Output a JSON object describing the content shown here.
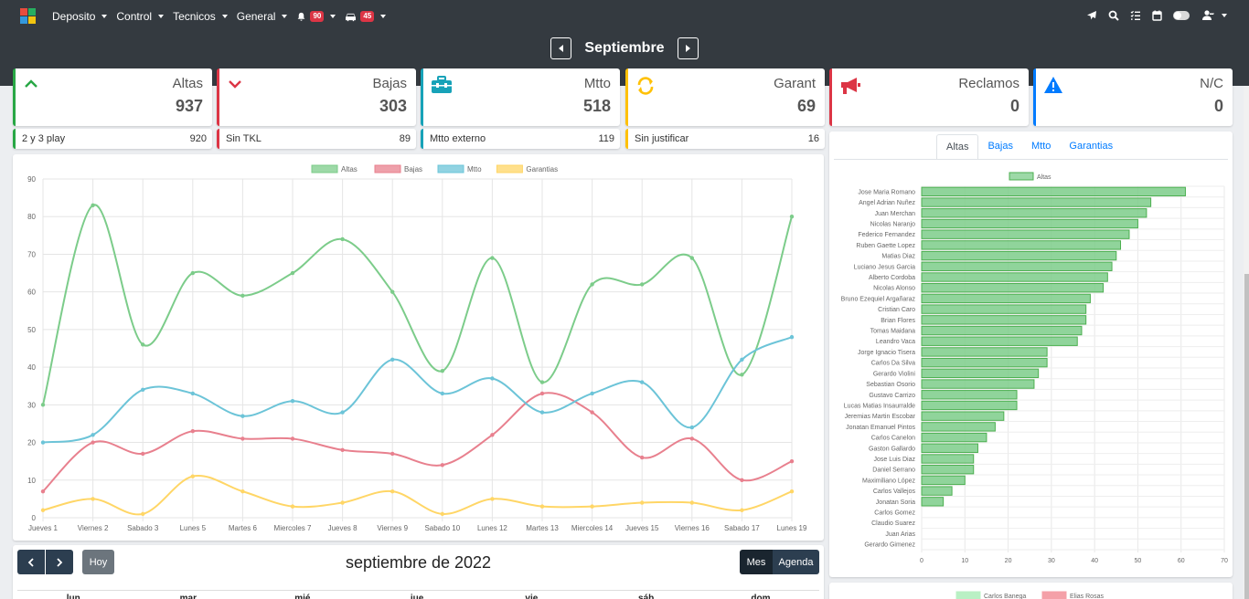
{
  "navbar": {
    "menus": [
      {
        "label": "Deposito"
      },
      {
        "label": "Control"
      },
      {
        "label": "Tecnicos"
      },
      {
        "label": "General"
      }
    ],
    "notifications_badge": "90",
    "vehicles_badge": "45",
    "icons": [
      "send-icon",
      "search-icon",
      "tasks-icon",
      "calendar-icon",
      "toggle",
      "user-icon"
    ]
  },
  "month": {
    "title": "Septiembre"
  },
  "stats": [
    {
      "title": "Altas",
      "value": "937",
      "icon": "chevron-up-icon",
      "color": "#28a745"
    },
    {
      "title": "Bajas",
      "value": "303",
      "icon": "chevron-down-icon",
      "color": "#dc3545"
    },
    {
      "title": "Mtto",
      "value": "518",
      "icon": "toolbox-icon",
      "color": "#17a2b8"
    },
    {
      "title": "Garant",
      "value": "69",
      "icon": "sync-icon",
      "color": "#ffc107"
    },
    {
      "title": "Reclamos",
      "value": "0",
      "icon": "bullhorn-icon",
      "color": "#dc3545"
    },
    {
      "title": "N/C",
      "value": "0",
      "icon": "warning-icon",
      "color": "#007bff"
    }
  ],
  "substats": [
    {
      "label": "2 y 3 play",
      "value": "920"
    },
    {
      "label": "Sin TKL",
      "value": "89"
    },
    {
      "label": "Mtto externo",
      "value": "119"
    },
    {
      "label": "Sin justificar",
      "value": "16"
    }
  ],
  "tabs": [
    {
      "label": "Altas",
      "active": true
    },
    {
      "label": "Bajas",
      "active": false
    },
    {
      "label": "Mtto",
      "active": false
    },
    {
      "label": "Garantias",
      "active": false
    }
  ],
  "calendar": {
    "title": "septiembre de 2022",
    "today_label": "Hoy",
    "view_month": "Mes",
    "view_agenda": "Agenda",
    "weekdays": [
      "lun.",
      "mar.",
      "mié.",
      "jue.",
      "vie.",
      "sáb.",
      "dom."
    ]
  },
  "bottom_legend": [
    {
      "name": "Carlos Banega",
      "color": "#b9f0c4"
    },
    {
      "name": "Elias Rosas",
      "color": "#f4a0a8"
    }
  ],
  "chart_data": [
    {
      "type": "line",
      "x": [
        "Jueves 1",
        "Viernes 2",
        "Sabado 3",
        "Lunes 5",
        "Martes 6",
        "Miercoles 7",
        "Jueves 8",
        "Viernes 9",
        "Sabado 10",
        "Lunes 12",
        "Martes 13",
        "Miercoles 14",
        "Jueves 15",
        "Viernes 16",
        "Sabado 17",
        "Lunes 19"
      ],
      "ylim": [
        0,
        90
      ],
      "yticks": [
        0,
        10,
        20,
        30,
        40,
        50,
        60,
        70,
        80,
        90
      ],
      "legend": "top-center",
      "grid": true,
      "series": [
        {
          "name": "Altas",
          "color": "#7ccc8a",
          "values": [
            30,
            83,
            46,
            65,
            59,
            65,
            74,
            60,
            39,
            69,
            36,
            62,
            62,
            69,
            38,
            80
          ]
        },
        {
          "name": "Bajas",
          "color": "#e8808e",
          "values": [
            7,
            20,
            17,
            23,
            21,
            21,
            18,
            17,
            14,
            22,
            33,
            28,
            16,
            21,
            10,
            15
          ]
        },
        {
          "name": "Mtto",
          "color": "#6cc4d8",
          "values": [
            20,
            22,
            34,
            33,
            27,
            31,
            28,
            42,
            33,
            37,
            28,
            33,
            36,
            24,
            42,
            48
          ]
        },
        {
          "name": "Garantias",
          "color": "#ffd666",
          "values": [
            2,
            5,
            1,
            11,
            7,
            3,
            4,
            7,
            1,
            5,
            3,
            3,
            4,
            4,
            2,
            7
          ]
        }
      ]
    },
    {
      "type": "bar",
      "orientation": "horizontal",
      "legend": "top-center",
      "xlim": [
        0,
        70
      ],
      "xticks": [
        0,
        10,
        20,
        30,
        40,
        50,
        60,
        70
      ],
      "grid": true,
      "categories": [
        "Jose Maria Romano",
        "Angel Adrian Nuñez",
        "Juan Merchan",
        "Nicolas Naranjo",
        "Federico Fernandez",
        "Ruben Gaette Lopez",
        "Matias Diaz",
        "Luciano Jesus Garcia",
        "Alberto Cordoba",
        "Nicolas Alonso",
        "Bruno Ezequiel Argañaraz",
        "Cristian Caro",
        "Brian Flores",
        "Tomas Maidana",
        "Leandro Vaca",
        "Jorge Ignacio Tisera",
        "Carlos Da Silva",
        "Gerardo Violini",
        "Sebastian Osorio",
        "Gustavo Carrizo",
        "Lucas Matias Insaurralde",
        "Jeremias Martin Escobar",
        "Jonatan Emanuel Pintos",
        "Carlos Canelon",
        "Gaston Gallardo",
        "Jose Luis Diaz",
        "Daniel Serrano",
        "Maximiliano  López",
        "Carlos Vallejos",
        "Jonatan Soria",
        "Carlos Gomez",
        "Claudio Suarez",
        "Juan Arias",
        "Gerardo Gimenez"
      ],
      "series": [
        {
          "name": "Altas",
          "color": "#7ccc8a",
          "values": [
            61,
            53,
            52,
            50,
            48,
            46,
            45,
            44,
            43,
            42,
            39,
            38,
            38,
            37,
            36,
            29,
            29,
            27,
            26,
            22,
            22,
            19,
            17,
            15,
            13,
            12,
            12,
            10,
            7,
            5,
            0,
            0,
            0,
            0
          ]
        }
      ]
    }
  ]
}
